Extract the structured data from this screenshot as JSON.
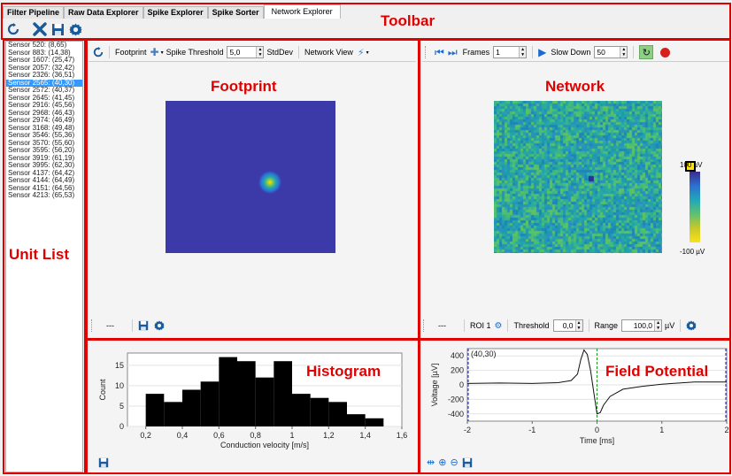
{
  "tabs": [
    "Filter Pipeline",
    "Raw Data Explorer",
    "Spike Explorer",
    "Spike Sorter",
    "Network Explorer"
  ],
  "active_tab": "Network Explorer",
  "annotations": {
    "toolbar": "Toolbar",
    "unit_list": "Unit List",
    "footprint": "Footprint",
    "network": "Network",
    "histogram": "Histogram",
    "field_potential": "Field Potential"
  },
  "main_toolbar_icons": [
    "refresh-icon",
    "close-icon",
    "save-icon",
    "gear-icon"
  ],
  "units": [
    "Sensor 520: (8,65)",
    "Sensor 883: (14,38)",
    "Sensor 1607: (25,47)",
    "Sensor 2057: (32,42)",
    "Sensor 2326: (36,51)",
    "Sensor 2565: (40,30)",
    "Sensor 2572: (40,37)",
    "Sensor 2645: (41,45)",
    "Sensor 2916: (45,56)",
    "Sensor 2968: (46,43)",
    "Sensor 2974: (46,49)",
    "Sensor 3168: (49,48)",
    "Sensor 3546: (55,36)",
    "Sensor 3570: (55,60)",
    "Sensor 3595: (56,20)",
    "Sensor 3919: (61,19)",
    "Sensor 3995: (62,30)",
    "Sensor 4137: (64,42)",
    "Sensor 4144: (64,49)",
    "Sensor 4151: (64,56)",
    "Sensor 4213: (65,53)"
  ],
  "selected_unit": "Sensor 2565: (40,30)",
  "footprint": {
    "toolbar": {
      "footprint_label": "Footprint",
      "spike_threshold_label": "Spike Threshold",
      "spike_threshold_value": "5,0",
      "unit": "StdDev",
      "network_view_label": "Network View"
    },
    "status": "---"
  },
  "network": {
    "toolbar": {
      "frames_label": "Frames",
      "frames_value": "1",
      "slow_down_label": "Slow Down",
      "slow_down_value": "50"
    },
    "colorbar": {
      "max_label": "100 µV",
      "min_label": "-100 µV"
    },
    "bottom": {
      "status": "---",
      "roi_label": "ROI 1",
      "threshold_label": "Threshold",
      "threshold_value": "0,0",
      "range_label": "Range",
      "range_value": "100,0",
      "range_unit": "µV"
    }
  },
  "chart_data": [
    {
      "type": "bar",
      "xlabel": "Conduction velocity [m/s]",
      "ylabel": "Count",
      "xlim": [
        0.1,
        1.6
      ],
      "ylim": [
        0,
        18
      ],
      "xticks": [
        "0,2",
        "0,4",
        "0,6",
        "0,8",
        "1",
        "1,2",
        "1,4",
        "1,6"
      ],
      "yticks": [
        "0",
        "5",
        "10",
        "15"
      ],
      "bin_starts": [
        0.2,
        0.3,
        0.4,
        0.5,
        0.6,
        0.7,
        0.8,
        0.9,
        1.0,
        1.1,
        1.2,
        1.3,
        1.4
      ],
      "bin_width": 0.1,
      "values": [
        8,
        6,
        9,
        11,
        17,
        16,
        12,
        16,
        8,
        7,
        6,
        3,
        2
      ],
      "grid": true
    },
    {
      "type": "line",
      "xlabel": "Time [ms]",
      "ylabel": "Voltage [µV]",
      "annotation": "(40,30)",
      "xlim": [
        -2,
        2
      ],
      "ylim": [
        -500,
        500
      ],
      "xticks": [
        "-2",
        "-1",
        "0",
        "1",
        "2"
      ],
      "yticks": [
        "400",
        "200",
        "0",
        "-200",
        "-400"
      ],
      "x": [
        -2,
        -1.5,
        -1,
        -0.6,
        -0.4,
        -0.3,
        -0.25,
        -0.2,
        -0.15,
        -0.1,
        -0.05,
        0,
        0.05,
        0.1,
        0.2,
        0.4,
        0.7,
        1.0,
        1.5,
        2
      ],
      "y": [
        20,
        25,
        20,
        30,
        60,
        150,
        350,
        480,
        420,
        200,
        -100,
        -400,
        -380,
        -280,
        -160,
        -60,
        -20,
        10,
        40,
        40
      ],
      "vlines": {
        "center": 0,
        "left": -2,
        "right": 2
      }
    }
  ]
}
